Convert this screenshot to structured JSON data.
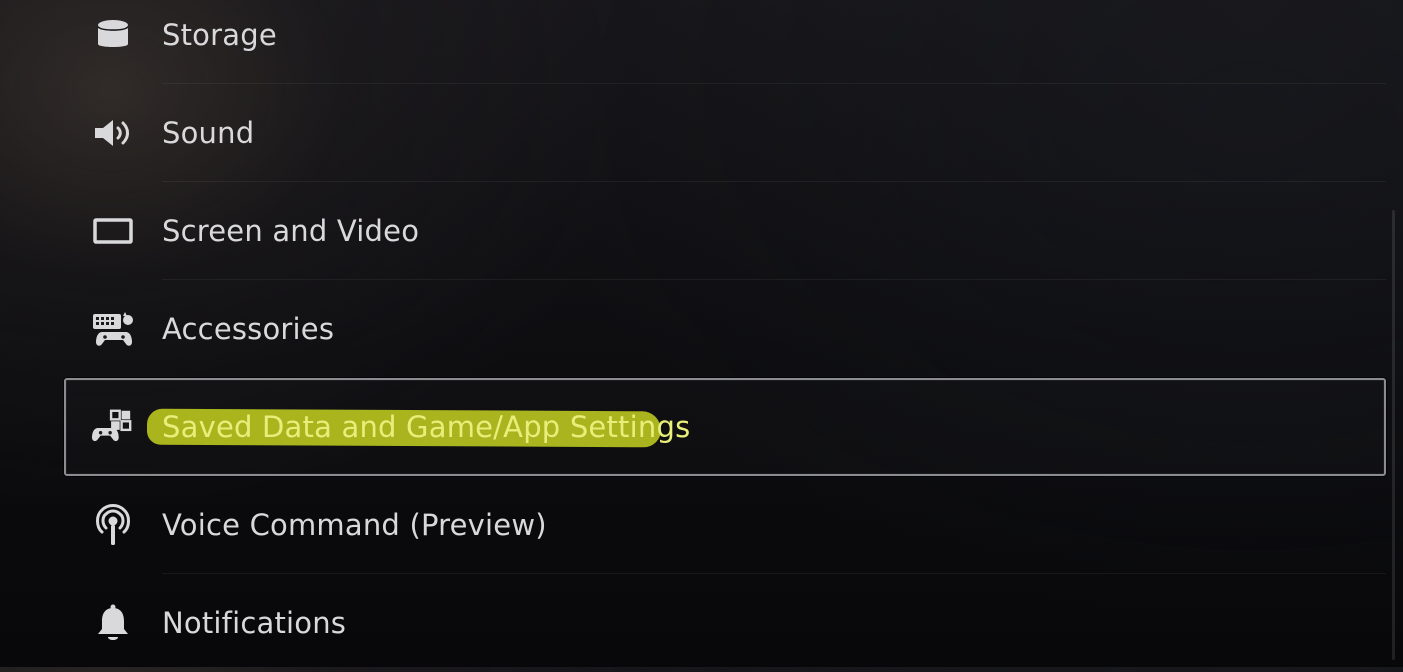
{
  "settings": {
    "items": [
      {
        "label": "Storage",
        "icon": "storage-icon"
      },
      {
        "label": "Sound",
        "icon": "speaker-icon"
      },
      {
        "label": "Screen and Video",
        "icon": "screen-icon"
      },
      {
        "label": "Accessories",
        "icon": "accessories-icon"
      },
      {
        "label": "Saved Data and Game/App Settings",
        "icon": "saved-data-icon",
        "selected": true,
        "highlighted": true
      },
      {
        "label": "Voice Command (Preview)",
        "icon": "voice-command-icon"
      },
      {
        "label": "Notifications",
        "icon": "bell-icon"
      }
    ]
  },
  "colors": {
    "background": "#0d0d10",
    "text": "#d9d9dc",
    "selection_border": "#8b8c90",
    "highlighter": "#b6c21c"
  }
}
